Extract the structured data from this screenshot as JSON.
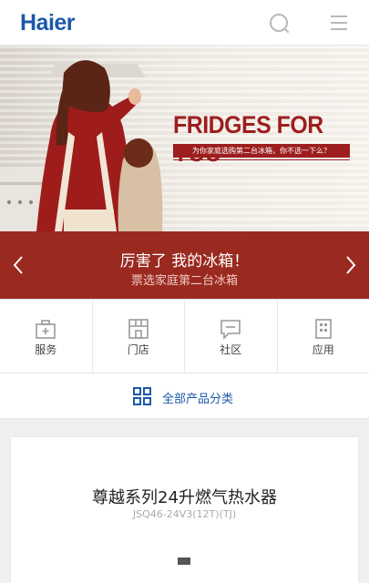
{
  "header": {
    "logo": "Haier",
    "search_icon": "search-icon",
    "menu_icon": "hamburger-menu-icon"
  },
  "banner": {
    "headline": "FRIDGES FOR YOU",
    "tagline": "为你家庭选购第二台冰箱，你不选一下么？",
    "caption_title": "厉害了 我的冰箱！",
    "caption_subtitle": "票选家庭第二台冰箱",
    "prev_icon": "chevron-left-icon",
    "next_icon": "chevron-right-icon"
  },
  "quicknav": {
    "items": [
      {
        "label": "服务",
        "icon": "service-kit-icon"
      },
      {
        "label": "门店",
        "icon": "store-icon"
      },
      {
        "label": "社区",
        "icon": "chat-icon"
      },
      {
        "label": "应用",
        "icon": "app-icon"
      }
    ]
  },
  "allcat": {
    "label": "全部产品分类",
    "icon": "grid-icon"
  },
  "product": {
    "title": "尊越系列24升燃气热水器",
    "model": "JSQ46-24V3(12T)(TJ)"
  },
  "colors": {
    "brand_blue": "#1c58a8",
    "caption_red": "#9a2a20",
    "banner_red": "#9d1e1e"
  }
}
